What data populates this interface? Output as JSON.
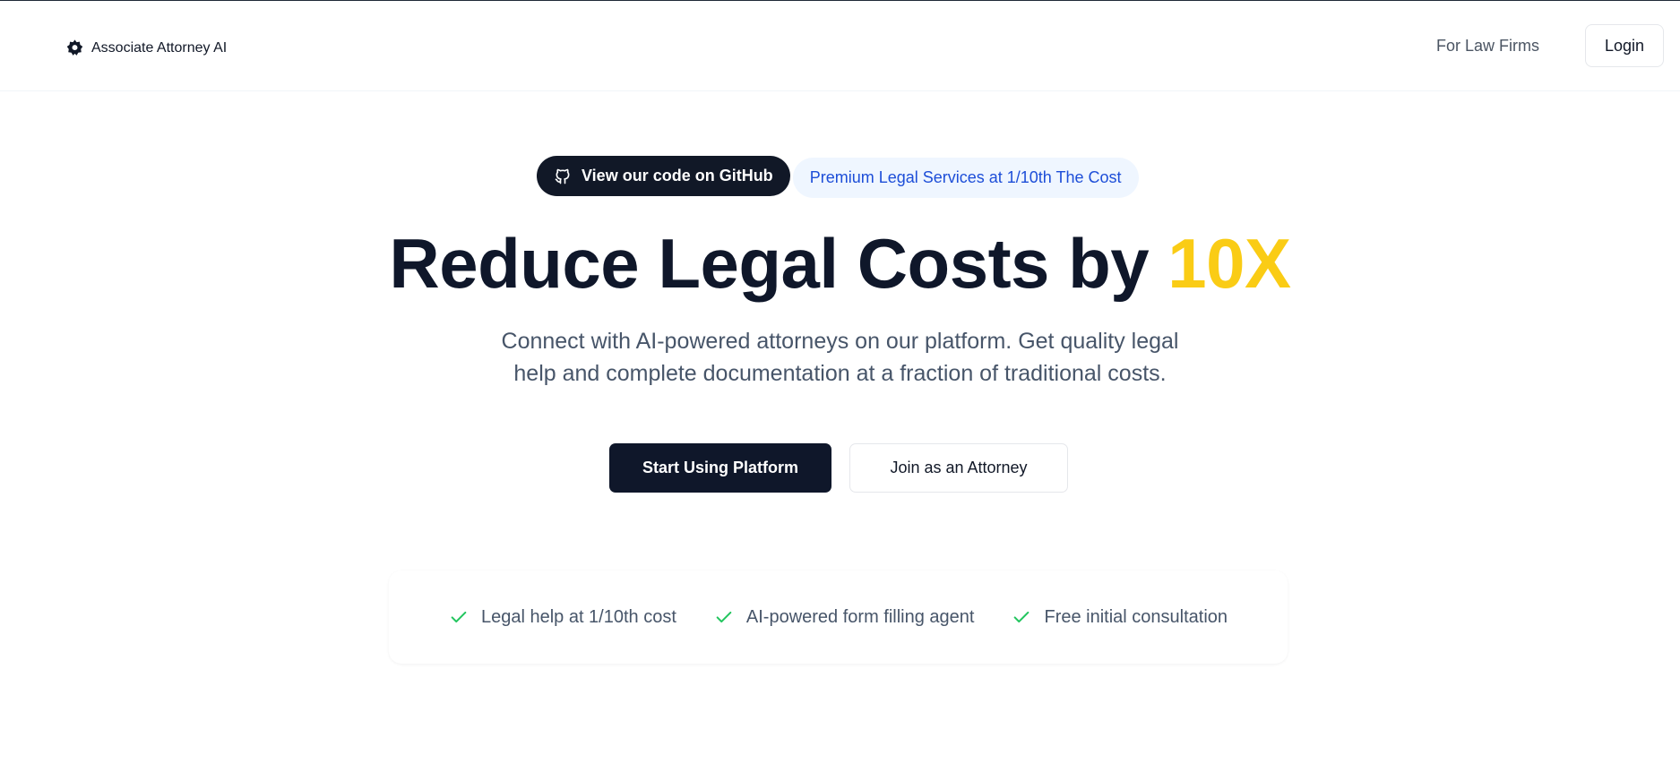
{
  "header": {
    "brand_name": "Associate Attorney AI",
    "brand_icon": "gear-star-icon",
    "nav_link": "For Law Firms",
    "login_label": "Login"
  },
  "badges": {
    "github_label": "View our code on GitHub",
    "github_icon": "github-icon",
    "promo_label": "Premium Legal Services at 1/10th The Cost"
  },
  "hero": {
    "headline_main": "Reduce Legal Costs by ",
    "headline_accent": "10X",
    "subtitle_line1": "Connect with AI-powered attorneys on our platform. Get quality legal",
    "subtitle_line2": "help and complete documentation at a fraction of traditional costs."
  },
  "cta": {
    "primary_label": "Start Using Platform",
    "secondary_label": "Join as an Attorney"
  },
  "features": [
    {
      "label": "Legal help at 1/10th cost",
      "icon": "check-icon"
    },
    {
      "label": "AI-powered form filling agent",
      "icon": "check-icon"
    },
    {
      "label": "Free initial consultation",
      "icon": "check-icon"
    }
  ],
  "colors": {
    "primary_dark": "#0f172a",
    "accent_yellow": "#facc15",
    "promo_blue": "#1d4ed8",
    "check_green": "#22c55e"
  }
}
